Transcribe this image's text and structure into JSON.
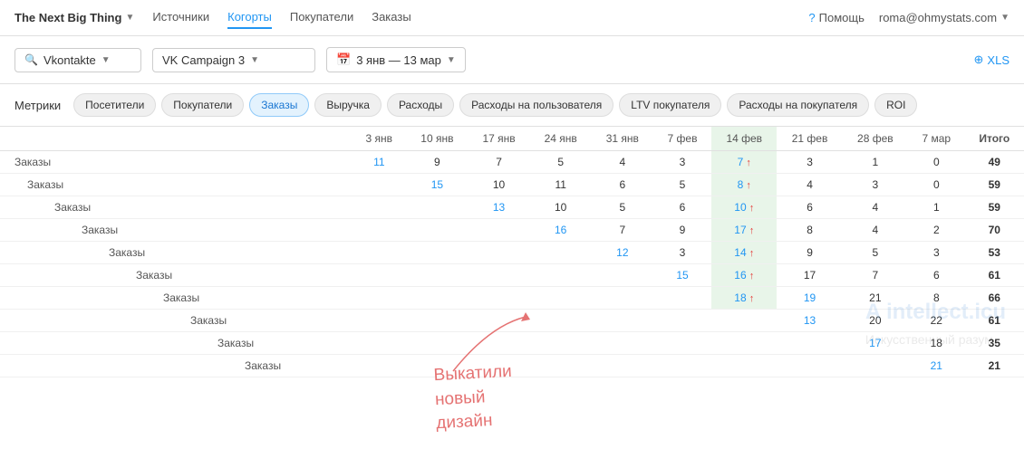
{
  "header": {
    "brand": "The Next Big Thing",
    "brand_arrow": "▼",
    "nav": [
      {
        "label": "Источники",
        "active": false
      },
      {
        "label": "Когорты",
        "active": true
      },
      {
        "label": "Покупатели",
        "active": false
      },
      {
        "label": "Заказы",
        "active": false
      }
    ],
    "help_label": "Помощь",
    "user_email": "roma@ohmystats.com",
    "user_arrow": "▼"
  },
  "filters": {
    "source_label": "Vkontakte",
    "campaign_label": "VK Campaign 3",
    "date_label": "3 янв — 13 мар",
    "xls_label": "XLS"
  },
  "metrics": {
    "label": "Метрики",
    "tabs": [
      {
        "label": "Посетители",
        "active": false
      },
      {
        "label": "Покупатели",
        "active": false
      },
      {
        "label": "Заказы",
        "active": true
      },
      {
        "label": "Выручка",
        "active": false
      },
      {
        "label": "Расходы",
        "active": false
      },
      {
        "label": "Расходы на пользователя",
        "active": false
      },
      {
        "label": "LTV покупателя",
        "active": false
      },
      {
        "label": "Расходы на покупателя",
        "active": false
      },
      {
        "label": "ROI",
        "active": false
      }
    ]
  },
  "table": {
    "columns": [
      "",
      "3 янв",
      "10 янв",
      "17 янв",
      "24 янв",
      "31 янв",
      "7 фев",
      "14 фев",
      "21 фев",
      "28 фев",
      "7 мар",
      "Итого"
    ],
    "rows": [
      {
        "label": "Заказы",
        "indent": 0,
        "values": [
          "11",
          "9",
          "7",
          "5",
          "4",
          "3",
          "7↑",
          "3",
          "1",
          "0",
          "49"
        ],
        "highlight_col": 6
      },
      {
        "label": "Заказы",
        "indent": 1,
        "values": [
          "",
          "15",
          "10",
          "11",
          "6",
          "5",
          "8↑",
          "4",
          "3",
          "0",
          "59"
        ],
        "highlight_col": 6
      },
      {
        "label": "Заказы",
        "indent": 2,
        "values": [
          "",
          "",
          "13",
          "10",
          "5",
          "6",
          "10↑",
          "6",
          "4",
          "1",
          "59"
        ],
        "highlight_col": 6
      },
      {
        "label": "Заказы",
        "indent": 3,
        "values": [
          "",
          "",
          "",
          "16",
          "7",
          "9",
          "17↑",
          "8",
          "4",
          "2",
          "70"
        ],
        "highlight_col": 6
      },
      {
        "label": "Заказы",
        "indent": 4,
        "values": [
          "",
          "",
          "",
          "",
          "12",
          "3",
          "14↑",
          "9",
          "5",
          "3",
          "53"
        ],
        "highlight_col": 6
      },
      {
        "label": "Заказы",
        "indent": 5,
        "values": [
          "",
          "",
          "",
          "",
          "",
          "15",
          "16↑",
          "17",
          "7",
          "6",
          "61"
        ],
        "highlight_col": 6
      },
      {
        "label": "Заказы",
        "indent": 6,
        "values": [
          "",
          "",
          "",
          "",
          "",
          "",
          "18↑",
          "19",
          "21",
          "8",
          "66"
        ],
        "highlight_col": 6
      },
      {
        "label": "Заказы",
        "indent": 7,
        "values": [
          "",
          "",
          "",
          "",
          "",
          "",
          "",
          "13",
          "20",
          "22",
          "61"
        ],
        "highlight_col": null
      },
      {
        "label": "Заказы",
        "indent": 8,
        "values": [
          "",
          "",
          "",
          "",
          "",
          "",
          "",
          "",
          "17",
          "18",
          "35"
        ],
        "highlight_col": null
      },
      {
        "label": "Заказы",
        "indent": 9,
        "values": [
          "",
          "",
          "",
          "",
          "",
          "",
          "",
          "",
          "",
          "21",
          "21"
        ],
        "highlight_col": null
      }
    ]
  },
  "annotation": {
    "text": "Выкатили\nновый\nдизайн"
  }
}
